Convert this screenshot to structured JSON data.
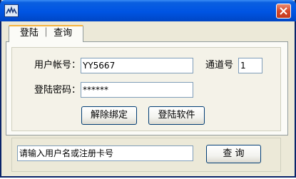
{
  "window": {
    "title": ""
  },
  "tabs": [
    {
      "label": "登陆 ｜ 查询"
    }
  ],
  "login": {
    "account_label": "用户帐号：",
    "account_value": "YY5667",
    "password_label": "登陆密码：",
    "password_value": "******",
    "channel_label": "通道号",
    "channel_value": "1",
    "unbind_button": "解除绑定",
    "login_button": "登陆软件"
  },
  "query": {
    "input_value": "请输入用户名或注册卡号",
    "query_button": "查  询"
  },
  "icons": {
    "app": "app-icon",
    "close": "close-icon"
  },
  "colors": {
    "titlebar": "#0054e3",
    "close_button": "#d5482a",
    "tab_highlight": "#f6b33e"
  }
}
